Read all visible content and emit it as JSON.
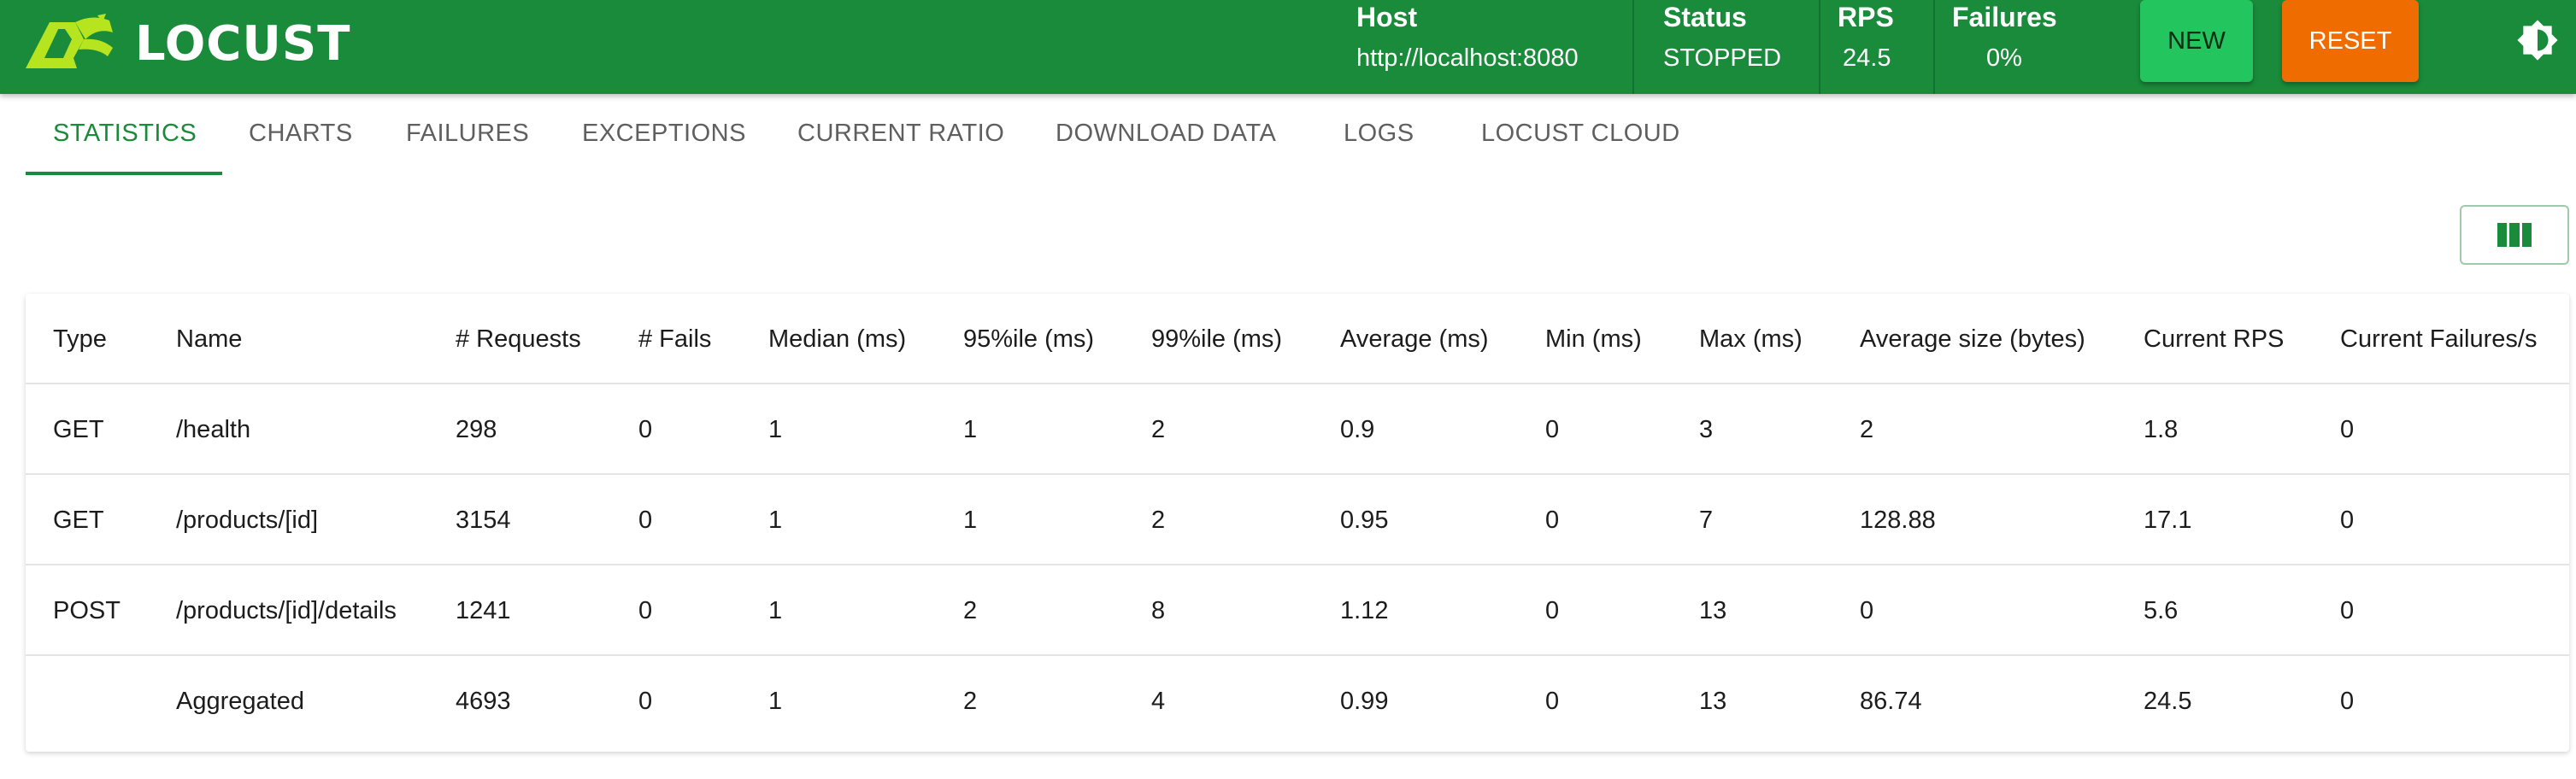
{
  "app": {
    "logo_text": "LOCUST"
  },
  "header": {
    "host_label": "Host",
    "host_value": "http://localhost:8080",
    "status_label": "Status",
    "status_value": "STOPPED",
    "rps_label": "RPS",
    "rps_value": "24.5",
    "failures_label": "Failures",
    "failures_value": "0%",
    "new_button": "NEW",
    "reset_button": "RESET",
    "theme_icon": "brightness-icon"
  },
  "tabs": [
    {
      "label": "STATISTICS",
      "active": true
    },
    {
      "label": "CHARTS"
    },
    {
      "label": "FAILURES"
    },
    {
      "label": "EXCEPTIONS"
    },
    {
      "label": "CURRENT RATIO"
    },
    {
      "label": "DOWNLOAD DATA"
    },
    {
      "label": "LOGS"
    },
    {
      "label": "LOCUST CLOUD"
    }
  ],
  "columns_button_icon": "view-columns-icon",
  "table": {
    "headers": [
      "Type",
      "Name",
      "# Requests",
      "# Fails",
      "Median (ms)",
      "95%ile (ms)",
      "99%ile (ms)",
      "Average (ms)",
      "Min (ms)",
      "Max (ms)",
      "Average size (bytes)",
      "Current RPS",
      "Current Failures/s"
    ],
    "rows": [
      [
        "GET",
        "/health",
        "298",
        "0",
        "1",
        "1",
        "2",
        "0.9",
        "0",
        "3",
        "2",
        "1.8",
        "0"
      ],
      [
        "GET",
        "/products/[id]",
        "3154",
        "0",
        "1",
        "1",
        "2",
        "0.95",
        "0",
        "7",
        "128.88",
        "17.1",
        "0"
      ],
      [
        "POST",
        "/products/[id]/details",
        "1241",
        "0",
        "1",
        "2",
        "8",
        "1.12",
        "0",
        "13",
        "0",
        "5.6",
        "0"
      ],
      [
        "",
        "Aggregated",
        "4693",
        "0",
        "1",
        "2",
        "4",
        "0.99",
        "0",
        "13",
        "86.74",
        "24.5",
        "0"
      ]
    ]
  },
  "colors": {
    "brand_green": "#1a8a3b",
    "new_green": "#22c55e",
    "reset_orange": "#ef6c00"
  }
}
